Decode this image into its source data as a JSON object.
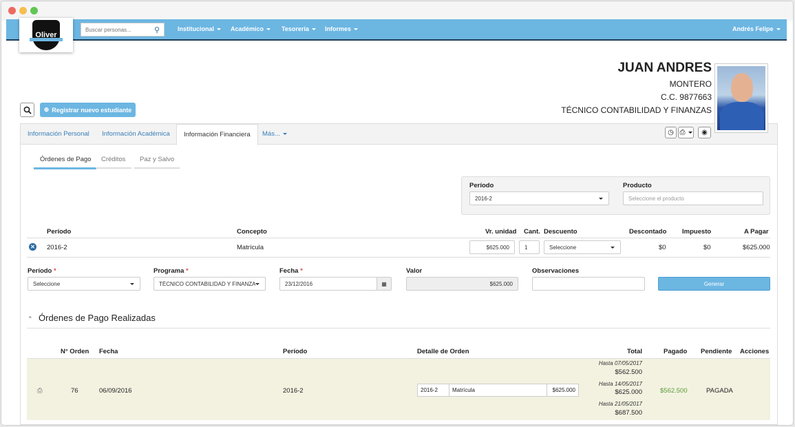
{
  "navbar": {
    "logo_text": "Oliver",
    "search_placeholder": "Buscar personas...",
    "menu": [
      "Institucional",
      "Académico",
      "Tesorería",
      "Informes"
    ],
    "user": "Andrés Felipe"
  },
  "student": {
    "name": "JUAN ANDRES",
    "surname": "MONTERO",
    "id": "C.C. 9877663",
    "program": "TÉCNICO CONTABILIDAD Y FINANZAS"
  },
  "actions": {
    "register": "Registrar nuevo estudiante"
  },
  "tabs": [
    "Información Personal",
    "Información Académica",
    "Información Financiera",
    "Más..."
  ],
  "subtabs": [
    "Órdenes de Pago",
    "Créditos",
    "Paz y Salvo"
  ],
  "filter": {
    "period_label": "Período",
    "period_value": "2016-2",
    "product_label": "Producto",
    "product_placeholder": "Seleccione el producto"
  },
  "concepts_table": {
    "headers": [
      "Período",
      "Concepto",
      "Vr. unidad",
      "Cant.",
      "Descuento",
      "Descontado",
      "Impuesto",
      "A Pagar"
    ],
    "row": {
      "period": "2016-2",
      "concept": "Matrícula",
      "unit_value": "$625.000",
      "qty": "1",
      "discount": "Seleccione",
      "discounted": "$0",
      "tax": "$0",
      "to_pay": "$625.000"
    }
  },
  "form": {
    "period_label": "Período",
    "period_value": "Seleccione",
    "program_label": "Programa",
    "program_value": "TÉCNICO CONTABILIDAD Y FINANZAS",
    "date_label": "Fecha",
    "date_value": "23/12/2016",
    "value_label": "Valor",
    "value_value": "$625.000",
    "obs_label": "Observaciones",
    "obs_value": "",
    "generate": "Generar",
    "required_mark": "*"
  },
  "orders": {
    "title": "Órdenes de Pago Realizadas",
    "headers": [
      "N° Orden",
      "Fecha",
      "Período",
      "Detalle de Orden",
      "Total",
      "Pagado",
      "Pendiente",
      "Acciones"
    ],
    "row": {
      "order_no": "76",
      "date": "06/09/2016",
      "period": "2016-2",
      "detail_period": "2016-2",
      "detail_concept": "Matrícula",
      "detail_value": "$625.000",
      "totals": [
        {
          "until": "Hasta 07/05/2017",
          "amount": "$562.500"
        },
        {
          "until": "Hasta 14/05/2017",
          "amount": "$625.000"
        },
        {
          "until": "Hasta 21/05/2017",
          "amount": "$687.500"
        }
      ],
      "paid": "$562.500",
      "pending": "PAGADA"
    }
  },
  "colors": {
    "primary": "#6cb6e2",
    "link": "#3a7fb8",
    "paid_green": "#5a9b3a",
    "row_bg": "#f3f2e1"
  }
}
